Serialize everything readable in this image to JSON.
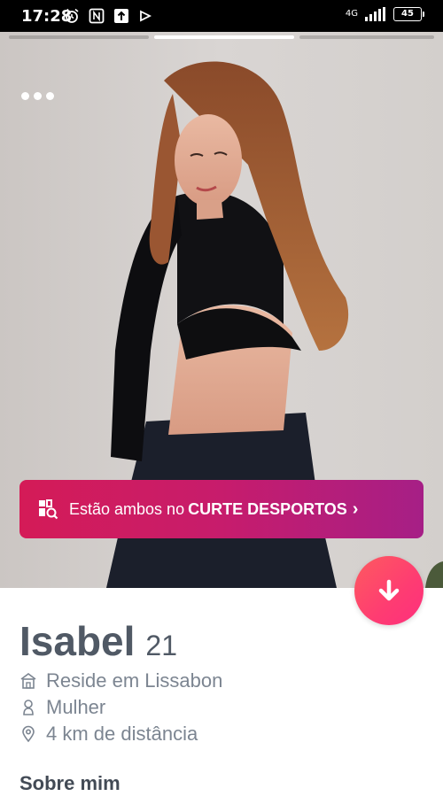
{
  "status_bar": {
    "time": "17:28",
    "network": "4G",
    "battery": "45"
  },
  "banner": {
    "prefix": "Estão ambos no",
    "highlight": "CURTE DESPORTOS",
    "chevron": "›",
    "icon": "community-icon"
  },
  "profile": {
    "name": "Isabel",
    "age": "21",
    "details": [
      {
        "icon": "home-icon",
        "text": "Reside em Lissabon"
      },
      {
        "icon": "person-icon",
        "text": "Mulher"
      },
      {
        "icon": "location-pin-icon",
        "text": "4 km de distância"
      }
    ],
    "section_title": "Sobre mim"
  },
  "colors": {
    "brand_gradient_start": "#fd5b5f",
    "brand_gradient_end": "#ff2f7d",
    "banner_start": "#d41b57",
    "banner_end": "#a61f86",
    "text_primary": "#505965",
    "text_secondary": "#7c8591"
  }
}
